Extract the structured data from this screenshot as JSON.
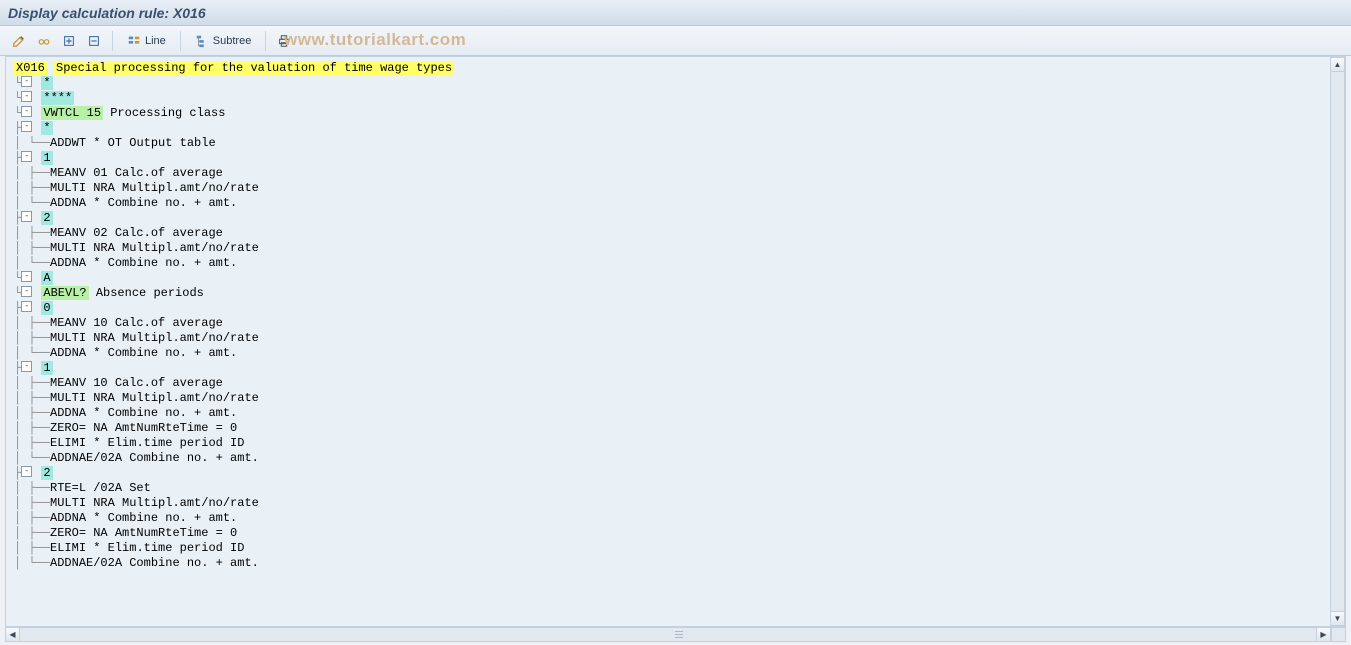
{
  "title": "Display calculation rule: X016",
  "toolbar": {
    "line_label": "Line",
    "subtree_label": "Subtree"
  },
  "watermark": "www.tutorialkart.com",
  "tree": {
    "root_code": "X016",
    "root_desc": "Special processing for the valuation of time wage types",
    "star": "*",
    "stars4": "****",
    "vwtcl": {
      "code": "VWTCL 15",
      "desc": "Processing class"
    },
    "vwtcl_star": "*",
    "addwt": {
      "code": "ADDWT *",
      "ot": "OT",
      "desc": "Output table"
    },
    "n1": "1",
    "n1_items": {
      "meanv": {
        "code": "MEANV 01",
        "desc": "Calc.of average"
      },
      "multi": {
        "code": "MULTI NRA",
        "desc": "Multipl.amt/no/rate"
      },
      "addna": {
        "code": "ADDNA *",
        "desc": "Combine no. + amt."
      }
    },
    "n2": "2",
    "n2_items": {
      "meanv": {
        "code": "MEANV 02",
        "desc": "Calc.of average"
      },
      "multi": {
        "code": "MULTI NRA",
        "desc": "Multipl.amt/no/rate"
      },
      "addna": {
        "code": "ADDNA *",
        "desc": "Combine no. + amt."
      }
    },
    "a": "A",
    "abevl": {
      "code": "ABEVL?",
      "desc": "Absence periods"
    },
    "a0": "0",
    "a0_items": {
      "meanv": {
        "code": "MEANV 10",
        "desc": "Calc.of average"
      },
      "multi": {
        "code": "MULTI NRA",
        "desc": "Multipl.amt/no/rate"
      },
      "addna": {
        "code": "ADDNA *",
        "desc": "Combine no. + amt."
      }
    },
    "a1": "1",
    "a1_items": {
      "meanv": {
        "code": "MEANV 10",
        "desc": "Calc.of average"
      },
      "multi": {
        "code": "MULTI NRA",
        "desc": "Multipl.amt/no/rate"
      },
      "addna": {
        "code": "ADDNA *",
        "desc": "Combine no. + amt."
      },
      "zero": {
        "code": "ZERO= NA",
        "desc": "AmtNumRteTime = 0"
      },
      "elimi": {
        "code": "ELIMI *",
        "desc": "Elim.time period ID"
      },
      "addnae": {
        "code": "ADDNAE/02A",
        "desc": "Combine no. + amt."
      }
    },
    "a2": "2",
    "a2_items": {
      "rte": {
        "code": "RTE=L /02A",
        "desc": "Set"
      },
      "multi": {
        "code": "MULTI NRA",
        "desc": "Multipl.amt/no/rate"
      },
      "addna": {
        "code": "ADDNA *",
        "desc": "Combine no. + amt."
      },
      "zero": {
        "code": "ZERO= NA",
        "desc": "AmtNumRteTime = 0"
      },
      "elimi": {
        "code": "ELIMI *",
        "desc": "Elim.time period ID"
      },
      "addnae": {
        "code": "ADDNAE/02A",
        "desc": "Combine no. + amt."
      }
    }
  }
}
